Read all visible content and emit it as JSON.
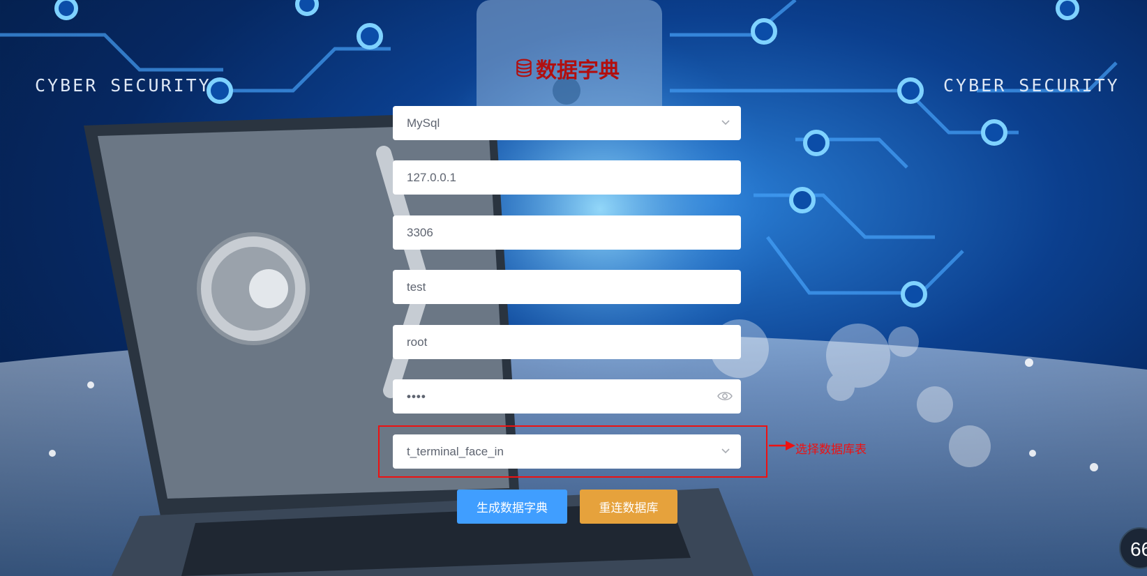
{
  "banner": {
    "left_text": "CYBER SECURITY",
    "right_text": "CYBER SECURITY"
  },
  "header": {
    "title": "数据字典",
    "icon": "database-icon"
  },
  "form": {
    "db_type": {
      "value": "MySql",
      "icon": "chevron-down-icon"
    },
    "host": {
      "value": "127.0.0.1"
    },
    "port": {
      "value": "3306"
    },
    "database": {
      "value": "test"
    },
    "username": {
      "value": "root"
    },
    "password": {
      "value": "••••",
      "icon": "eye-icon"
    },
    "table": {
      "value": "t_terminal_face_in",
      "icon": "chevron-down-icon"
    }
  },
  "annotation": {
    "text": "选择数据库表",
    "color": "#ee1111"
  },
  "buttons": {
    "generate": "生成数据字典",
    "reconnect": "重连数据库"
  },
  "colors": {
    "primary": "#409eff",
    "warning": "#e6a23c",
    "title": "#b10f0f"
  },
  "widget": {
    "value": "66"
  }
}
